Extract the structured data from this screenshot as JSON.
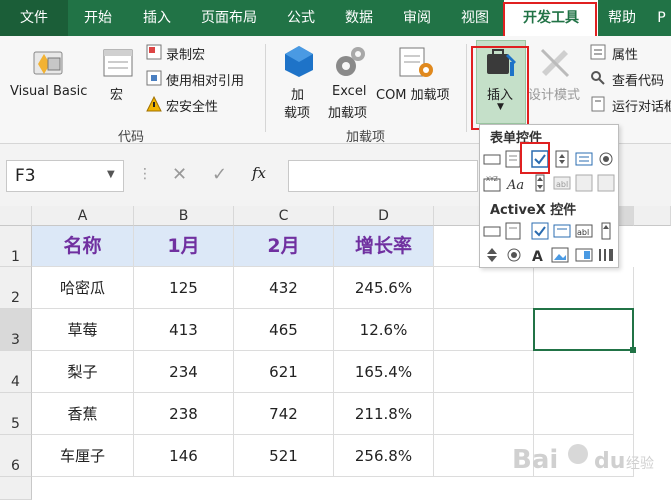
{
  "ribbon_tabs": [
    "文件",
    "开始",
    "插入",
    "页面布局",
    "公式",
    "数据",
    "审阅",
    "视图",
    "开发工具",
    "帮助",
    "P"
  ],
  "ribbon": {
    "visual_basic": "Visual Basic",
    "macro": "宏",
    "record_macro": "录制宏",
    "use_relative": "使用相对引用",
    "macro_security": "宏安全性",
    "group_code": "代码",
    "addins": [
      "加",
      "载项"
    ],
    "excel_addins": [
      "Excel",
      "加载项"
    ],
    "com_addins": "COM 加载项",
    "group_addins": "加载项",
    "insert": "插入",
    "design_mode": "设计模式",
    "properties": "属性",
    "view_code": "查看代码",
    "run_dialog": "运行对话框"
  },
  "formula_bar": {
    "name_box": "F3",
    "fx": "fx"
  },
  "dropdown": {
    "form_controls": "表单控件",
    "activex_controls": "ActiveX 控件"
  },
  "grid": {
    "columns": [
      "A",
      "B",
      "C",
      "D"
    ],
    "rows": [
      "1",
      "2",
      "3",
      "4",
      "5",
      "6"
    ],
    "header": [
      "名称",
      "1月",
      "2月",
      "增长率"
    ],
    "data": [
      [
        "哈密瓜",
        "125",
        "432",
        "245.6%"
      ],
      [
        "草莓",
        "413",
        "465",
        "12.6%"
      ],
      [
        "梨子",
        "234",
        "621",
        "165.4%"
      ],
      [
        "香蕉",
        "238",
        "742",
        "211.8%"
      ],
      [
        "车厘子",
        "146",
        "521",
        "256.8%"
      ]
    ]
  },
  "watermark": "Baidu经验",
  "colors": {
    "excel_green": "#217346",
    "highlight_red": "#e02020",
    "header_fill": "#dce8f7",
    "header_text": "#7030a0"
  }
}
